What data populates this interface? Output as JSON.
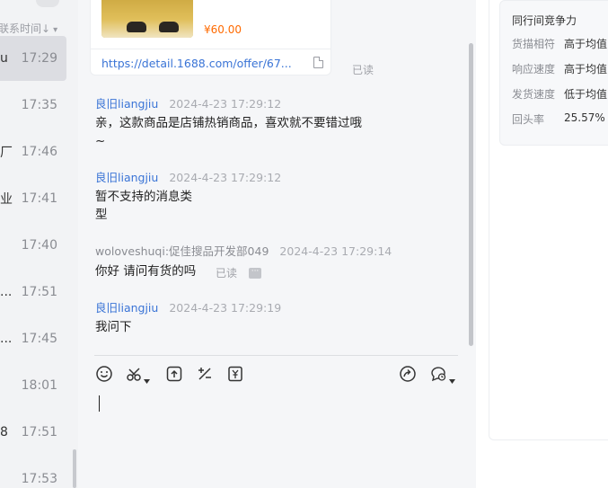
{
  "contacts": {
    "sort_label": "联系时间↓",
    "items": [
      {
        "name": "u",
        "time": "17:29"
      },
      {
        "name": "",
        "time": "17:35"
      },
      {
        "name": "厂",
        "time": "17:46"
      },
      {
        "name": "业",
        "time": "17:41"
      },
      {
        "name": "",
        "time": "17:40"
      },
      {
        "name": "...",
        "time": "17:51"
      },
      {
        "name": "...",
        "time": "17:45"
      },
      {
        "name": "",
        "time": "18:01"
      },
      {
        "name": "8",
        "time": "17:51"
      },
      {
        "name": "",
        "time": "17:53"
      }
    ]
  },
  "chat": {
    "product_card": {
      "price": "¥60.00",
      "link": "https://detail.1688.com/offer/67..."
    },
    "read_label": "已读",
    "messages": [
      {
        "sender": "良旧liangjiu",
        "time": "2024-4-23 17:29:12",
        "text_line1": "亲，这款商品是店铺热销商品，喜欢就不要错过哦",
        "text_line2": "~"
      },
      {
        "sender": "良旧liangjiu",
        "time": "2024-4-23 17:29:12",
        "text_line1": "暂不支持的消息类",
        "text_line2": "型"
      },
      {
        "sender": "woloveshuqi:促佳搜品开发部049",
        "time": "2024-4-23 17:29:14",
        "text_line1": "你好 请问有货的吗"
      },
      {
        "sender": "良旧liangjiu",
        "time": "2024-4-23 17:29:19",
        "text_line1": "我问下"
      }
    ],
    "toolbar_icons": [
      "emoji-icon",
      "scissors-icon",
      "upload-icon",
      "percent-icon",
      "yuan-icon",
      "share-icon",
      "quick-reply-icon"
    ]
  },
  "compete": {
    "title": "同行间竞争力",
    "rows": [
      {
        "label": "货描相符",
        "value": "高于均值"
      },
      {
        "label": "响应速度",
        "value": "高于均值"
      },
      {
        "label": "发货速度",
        "value": "低于均值"
      },
      {
        "label": "回头率",
        "value": "25.57%"
      }
    ]
  }
}
